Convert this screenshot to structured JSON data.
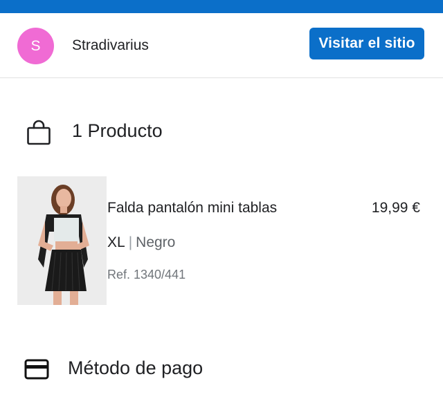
{
  "header": {
    "avatar_letter": "S",
    "store_name": "Stradivarius",
    "visit_button_label": "Visitar el sitio",
    "accent_color": "#0b6fc9",
    "avatar_color": "#f06bd4"
  },
  "products_section": {
    "icon": "shopping-bag-icon",
    "title": "1 Producto",
    "items": [
      {
        "name": "Falda pantalón mini tablas",
        "price": "19,99 €",
        "size": "XL",
        "separator": "|",
        "color": "Negro",
        "ref": "Ref. 1340/441"
      }
    ]
  },
  "payment_section": {
    "icon": "credit-card-icon",
    "title": "Método de pago"
  }
}
